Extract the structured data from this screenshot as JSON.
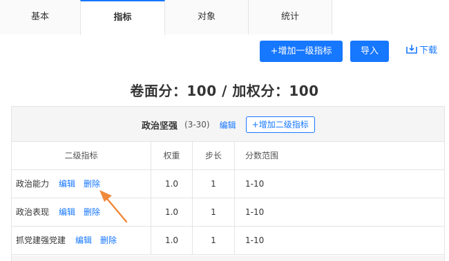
{
  "tabs": [
    {
      "label": "基本"
    },
    {
      "label": "指标"
    },
    {
      "label": "对象"
    },
    {
      "label": "统计"
    }
  ],
  "toolbar": {
    "add_level1_label": "+增加一级指标",
    "import_label": "导入",
    "download_label": "下载"
  },
  "score_line": "卷面分：100 / 加权分：100",
  "level1": {
    "name": "政治坚强",
    "range": "(3-30)",
    "edit_label": "编辑",
    "add_level2_label": "+增加二级指标"
  },
  "table": {
    "headers": [
      "二级指标",
      "权重",
      "步长",
      "分数范围"
    ],
    "rows": [
      {
        "name": "政治能力",
        "weight": "1.0",
        "step": "1",
        "range": "1-10",
        "edit": "编辑",
        "delete": "删除"
      },
      {
        "name": "政治表现",
        "weight": "1.0",
        "step": "1",
        "range": "1-10",
        "edit": "编辑",
        "delete": "删除"
      },
      {
        "name": "抓党建强党建",
        "weight": "1.0",
        "step": "1",
        "range": "1-10",
        "edit": "编辑",
        "delete": "删除"
      }
    ]
  },
  "colors": {
    "accent": "#1677ff",
    "annotation_arrow": "#f08a3c"
  }
}
